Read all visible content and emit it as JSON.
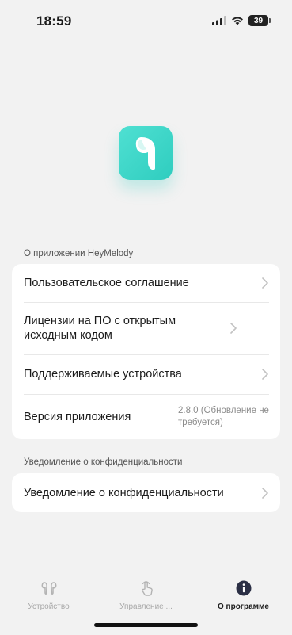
{
  "status_bar": {
    "time": "18:59",
    "battery": "39"
  },
  "sections": {
    "about_title": "О приложении HeyMelody",
    "about_items": [
      {
        "label": "Пользовательское соглашение"
      },
      {
        "label": "Лицензии на ПО с открытым исходным кодом"
      },
      {
        "label": "Поддерживаемые устройства"
      }
    ],
    "version": {
      "label": "Версия приложения",
      "value": "2.8.0 (Обновление не требуется)"
    },
    "privacy_title": "Уведомление о конфиденциальности",
    "privacy_item": {
      "label": "Уведомление о конфиденциальности"
    }
  },
  "tab_bar": {
    "tabs": [
      {
        "label": "Устройство",
        "icon": "earbuds-icon"
      },
      {
        "label": "Управление ...",
        "icon": "touch-gesture-icon"
      },
      {
        "label": "О программе",
        "icon": "info-icon"
      }
    ],
    "active_index": 2
  },
  "colors": {
    "accent": "#2fcdbf",
    "background": "#f2f2f2",
    "card": "#ffffff"
  }
}
